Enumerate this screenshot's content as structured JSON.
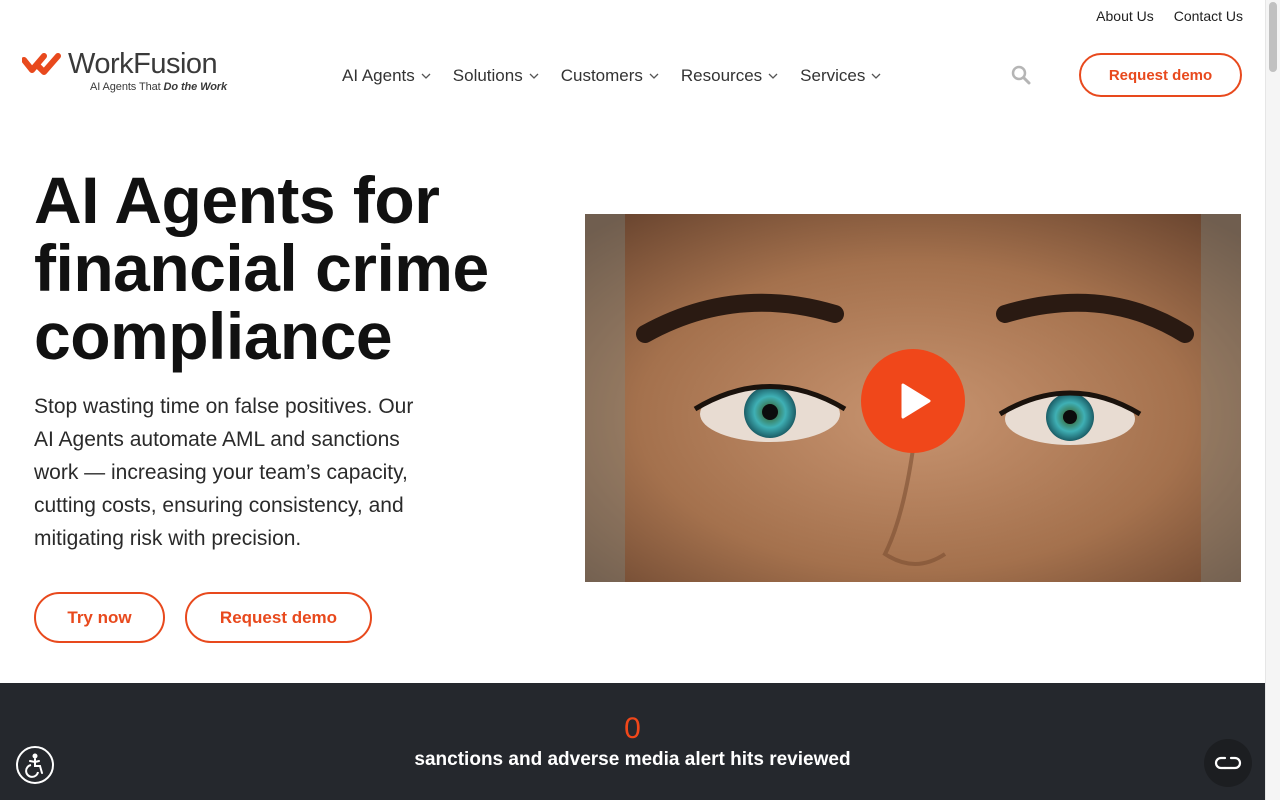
{
  "utility": {
    "about": "About Us",
    "contact": "Contact Us"
  },
  "logo": {
    "name": "WorkFusion",
    "tagline_prefix": "AI Agents That",
    "tagline_emph": "Do the Work"
  },
  "nav": [
    {
      "label": "AI Agents"
    },
    {
      "label": "Solutions"
    },
    {
      "label": "Customers"
    },
    {
      "label": "Resources"
    },
    {
      "label": "Services"
    }
  ],
  "header": {
    "request_demo": "Request demo",
    "search_icon": "search-icon"
  },
  "hero": {
    "title_line1": "AI Agents for",
    "title_line2": "financial crime",
    "title_line3": "compliance",
    "subtitle": "Stop wasting time on false positives. Our AI Agents automate AML and sanctions work — increasing your team’s capacity, cutting costs, ensuring consistency, and mitigating risk with precision.",
    "try_now": "Try now",
    "request_demo": "Request demo"
  },
  "video": {
    "play_icon": "play-icon"
  },
  "stats": {
    "value": "0",
    "label": "sanctions and adverse media alert hits reviewed"
  },
  "colors": {
    "accent": "#e8491d",
    "band": "#25282d"
  }
}
